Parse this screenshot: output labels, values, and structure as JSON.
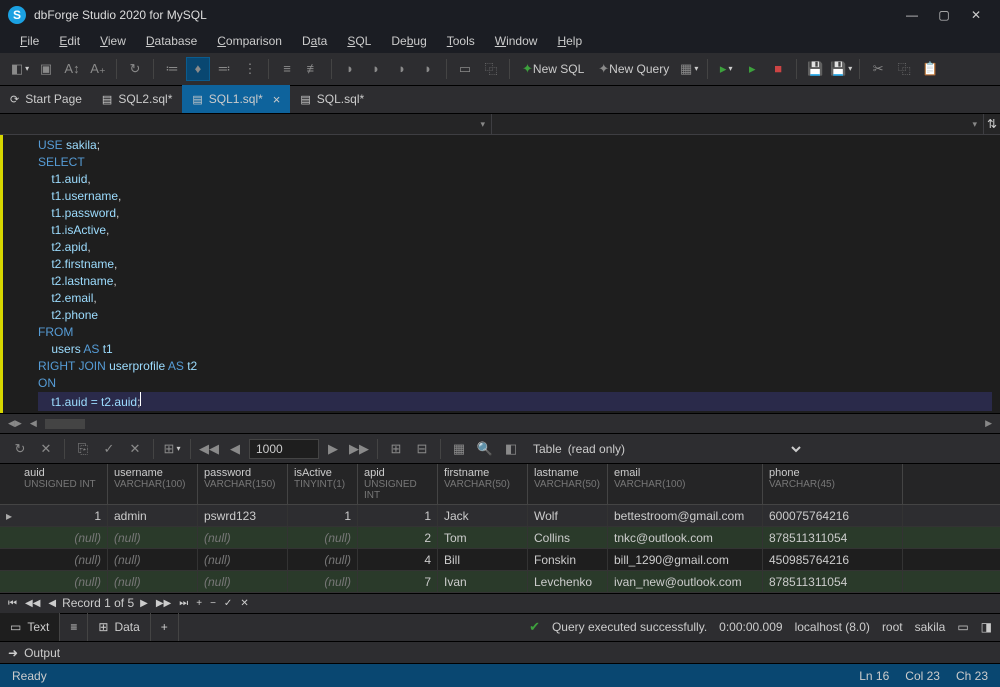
{
  "title": "dbForge Studio 2020 for MySQL",
  "menu": [
    "File",
    "Edit",
    "View",
    "Database",
    "Comparison",
    "Data",
    "SQL",
    "Debug",
    "Tools",
    "Window",
    "Help"
  ],
  "toolbar": {
    "newSql": "New SQL",
    "newQuery": "New Query"
  },
  "tabs": [
    {
      "label": "Start Page",
      "icon": "⟳"
    },
    {
      "label": "SQL2.sql*",
      "icon": "▤"
    },
    {
      "label": "SQL1.sql*",
      "icon": "▤",
      "active": true
    },
    {
      "label": "SQL.sql*",
      "icon": "▤"
    }
  ],
  "sql": {
    "l1": "USE",
    "l1b": "sakila",
    "sel": "SELECT",
    "c1": "t1.auid",
    "c2": "t1.username",
    "c3": "t1.password",
    "c4": "t1.isActive",
    "c5": "t2.apid",
    "c6": "t2.firstname",
    "c7": "t2.lastname",
    "c8": "t2.email",
    "c9": "t2.phone",
    "from": "FROM",
    "as": "AS",
    "users": "users",
    "t1": "t1",
    "rj": "RIGHT JOIN",
    "up": "userprofile",
    "t2": "t2",
    "on": "ON",
    "eq": "t1.auid = t2.auid"
  },
  "resultToolbar": {
    "page": "1000",
    "tableLabel": "Table",
    "mode": "(read only)"
  },
  "columns": [
    {
      "t": "auid",
      "s": "UNSIGNED INT",
      "cls": "col-auid"
    },
    {
      "t": "username",
      "s": "VARCHAR(100)",
      "cls": "col-username"
    },
    {
      "t": "password",
      "s": "VARCHAR(150)",
      "cls": "col-password"
    },
    {
      "t": "isActive",
      "s": "TINYINT(1)",
      "cls": "col-isActive"
    },
    {
      "t": "apid",
      "s": "UNSIGNED INT",
      "cls": "col-apid"
    },
    {
      "t": "firstname",
      "s": "VARCHAR(50)",
      "cls": "col-firstname"
    },
    {
      "t": "lastname",
      "s": "VARCHAR(50)",
      "cls": "col-lastname"
    },
    {
      "t": "email",
      "s": "VARCHAR(100)",
      "cls": "col-email"
    },
    {
      "t": "phone",
      "s": "VARCHAR(45)",
      "cls": "col-phone"
    }
  ],
  "rows": [
    {
      "sel": true,
      "d": [
        "1",
        "admin",
        "pswrd123",
        "1",
        "1",
        "Jack",
        "Wolf",
        "bettestroom@gmail.com",
        "600075764216"
      ]
    },
    {
      "odd": true,
      "d": [
        "(null)",
        "(null)",
        "(null)",
        "(null)",
        "2",
        "Tom",
        "Collins",
        "tnkc@outlook.com",
        "878511311054"
      ]
    },
    {
      "d": [
        "(null)",
        "(null)",
        "(null)",
        "(null)",
        "4",
        "Bill",
        "Fonskin",
        "bill_1290@gmail.com",
        "450985764216"
      ]
    },
    {
      "odd": true,
      "d": [
        "(null)",
        "(null)",
        "(null)",
        "(null)",
        "7",
        "Ivan",
        "Levchenko",
        "ivan_new@outlook.com",
        "878511311054"
      ]
    }
  ],
  "nav": {
    "label": "Record 1 of 5"
  },
  "btabs": {
    "text": "Text",
    "data": "Data"
  },
  "execStatus": {
    "msg": "Query executed successfully.",
    "time": "0:00:00.009",
    "host": "localhost (8.0)",
    "user": "root",
    "db": "sakila"
  },
  "output": "Output",
  "status": {
    "ready": "Ready",
    "ln": "Ln 16",
    "col": "Col 23",
    "ch": "Ch 23"
  }
}
